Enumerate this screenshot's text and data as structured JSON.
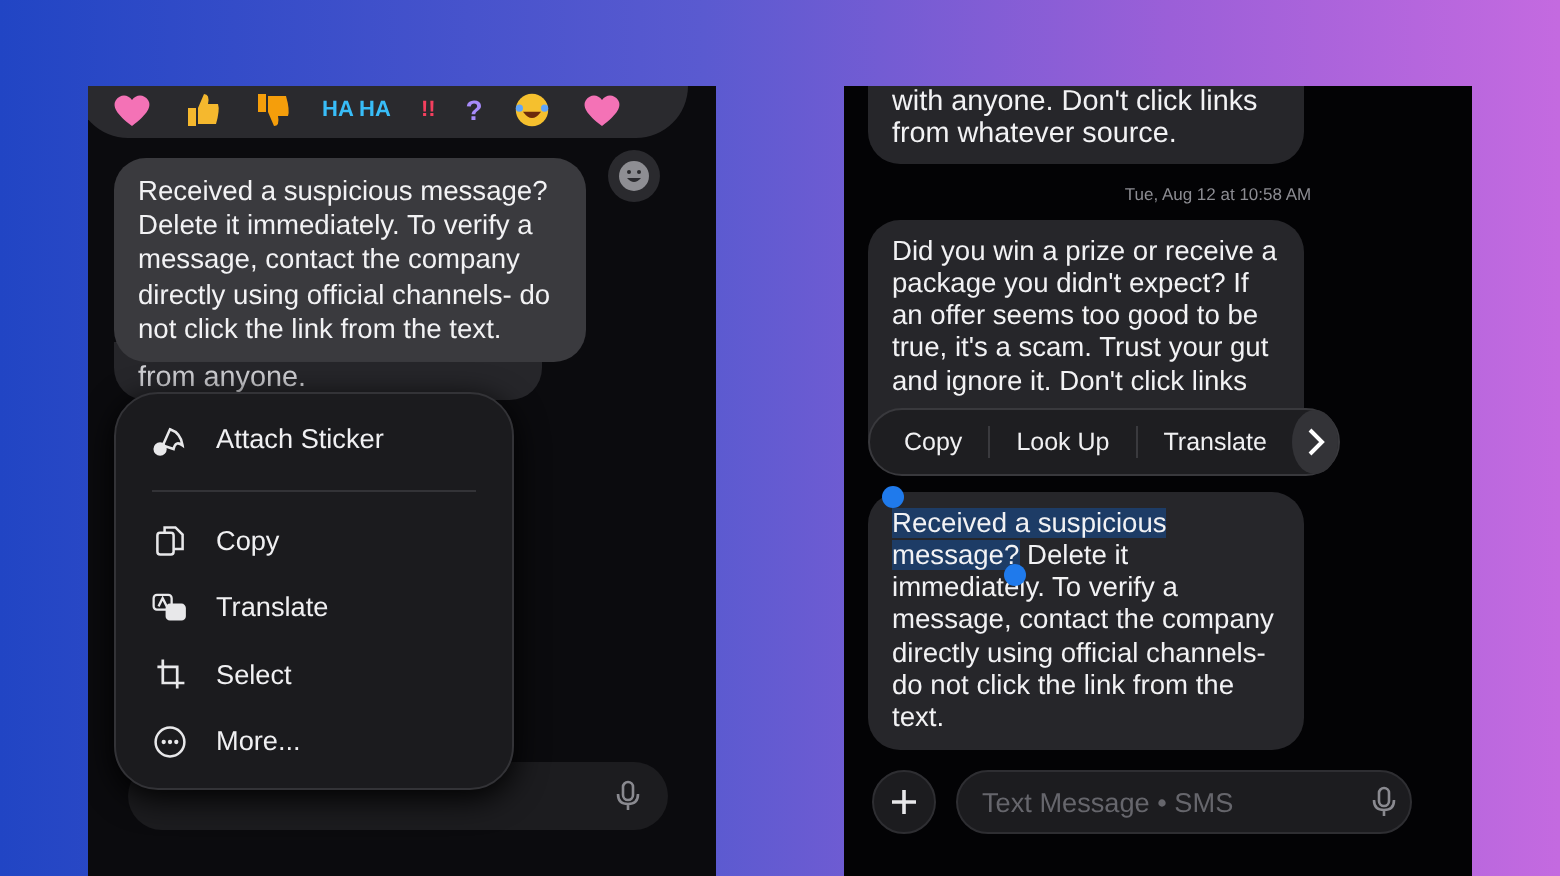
{
  "left_screen": {
    "reactions": [
      {
        "kind": "heart"
      },
      {
        "kind": "thumbs_up"
      },
      {
        "kind": "thumbs_down"
      },
      {
        "kind": "text",
        "text": "HA HA"
      },
      {
        "kind": "text",
        "text": "!!"
      },
      {
        "kind": "text",
        "text": "?"
      },
      {
        "kind": "laugh"
      },
      {
        "kind": "heart"
      }
    ],
    "focused_message": "Received a suspicious message? Delete it immediately. To verify a message, contact the company directly using official channels- do not click the link from the text.",
    "behind_message_tail": "from anyone.",
    "menu": [
      {
        "kind": "sticker",
        "label": "Attach Sticker"
      },
      {
        "kind": "copy",
        "label": "Copy"
      },
      {
        "kind": "translate",
        "label": "Translate"
      },
      {
        "kind": "select",
        "label": "Select"
      },
      {
        "kind": "more",
        "label": "More..."
      }
    ]
  },
  "right_screen": {
    "previous_message": "with anyone. Don't click links from whatever source.",
    "timestamp": "Tue, Aug 12 at 10:58 AM",
    "message": "Did you win a prize or receive a package you didn't expect? If an offer seems too good to be true, it's a scam. Trust your gut and ignore it. Don't click links",
    "edit_menu": [
      "Copy",
      "Look Up",
      "Translate"
    ],
    "selected_message": {
      "selected_text": "Received a suspicious message?",
      "rest": " Delete it immediately. To verify a message, contact the company directly using official channels- do not click the link from the text."
    },
    "composer": {
      "placeholder": "Text Message • SMS"
    }
  }
}
